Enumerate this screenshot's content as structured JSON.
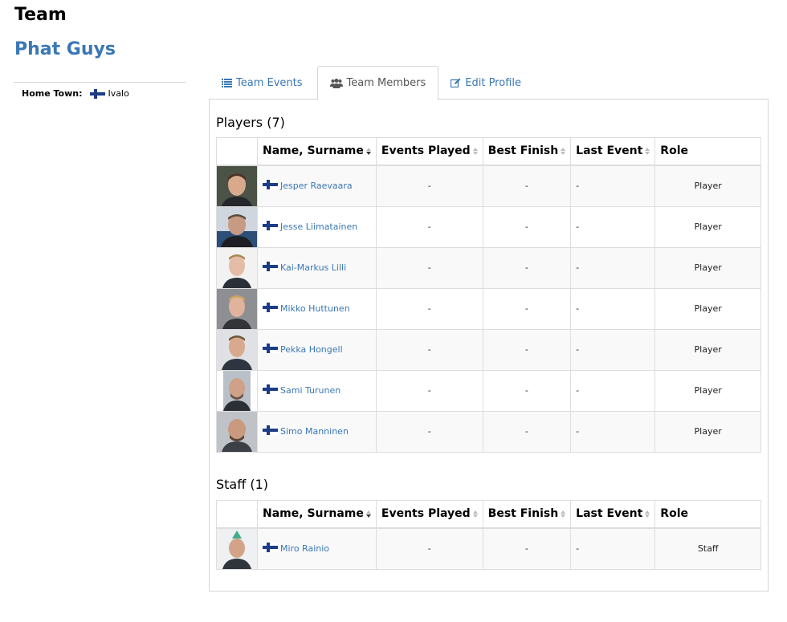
{
  "page": {
    "heading": "Team",
    "team_name": "Phat Guys"
  },
  "sidebar": {
    "hometown_label": "Home Town:",
    "hometown_value": "Ivalo",
    "hometown_flag": "finland-flag"
  },
  "tabs": [
    {
      "label": "Team Events",
      "icon": "list-icon",
      "active": false
    },
    {
      "label": "Team Members",
      "icon": "users-icon",
      "active": true
    },
    {
      "label": "Edit Profile",
      "icon": "edit-icon",
      "active": false
    }
  ],
  "columns": [
    "Name, Surname",
    "Events Played",
    "Best Finish",
    "Last Event",
    "Role"
  ],
  "players": {
    "title": "Players (7)",
    "rows": [
      {
        "name": "Jesper Raevaara",
        "events": "-",
        "best": "-",
        "last": "-",
        "role": "Player"
      },
      {
        "name": "Jesse Liimatainen",
        "events": "-",
        "best": "-",
        "last": "-",
        "role": "Player"
      },
      {
        "name": "Kai-Markus Lilli",
        "events": "-",
        "best": "-",
        "last": "-",
        "role": "Player"
      },
      {
        "name": "Mikko Huttunen",
        "events": "-",
        "best": "-",
        "last": "-",
        "role": "Player"
      },
      {
        "name": "Pekka Hongell",
        "events": "-",
        "best": "-",
        "last": "-",
        "role": "Player"
      },
      {
        "name": "Sami Turunen",
        "events": "-",
        "best": "-",
        "last": "-",
        "role": "Player"
      },
      {
        "name": "Simo Manninen",
        "events": "-",
        "best": "-",
        "last": "-",
        "role": "Player"
      }
    ]
  },
  "staff": {
    "title": "Staff (1)",
    "rows": [
      {
        "name": "Miro Rainio",
        "events": "-",
        "best": "-",
        "last": "-",
        "role": "Staff"
      }
    ]
  },
  "colors": {
    "link": "#3a77b5",
    "border": "#dddddd",
    "stripe": "#f9f9f9",
    "flag_blue": "#1b3c87"
  }
}
